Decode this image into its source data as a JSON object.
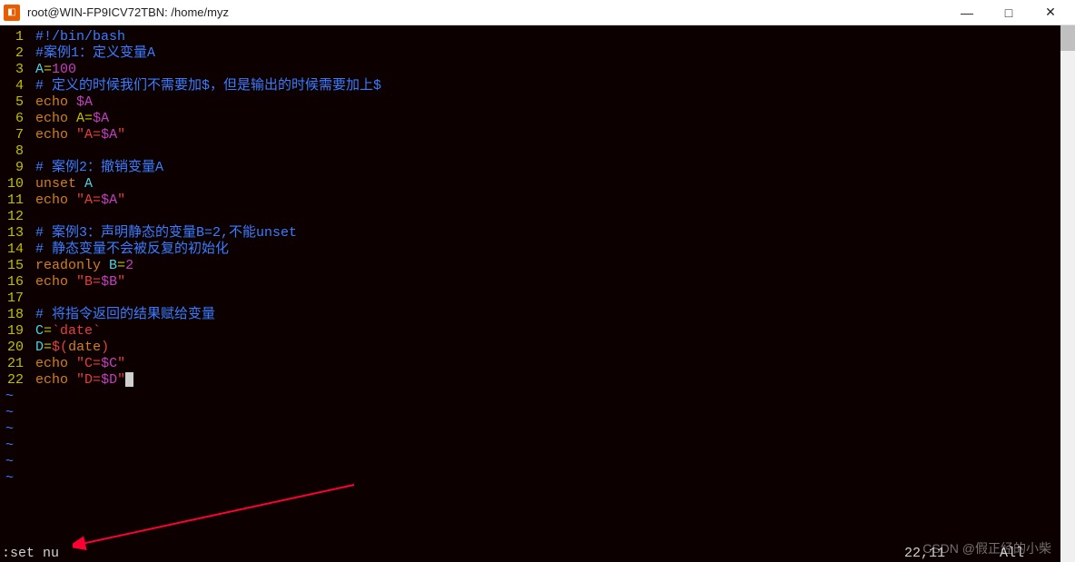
{
  "window": {
    "title": "root@WIN-FP9ICV72TBN: /home/myz",
    "controls": {
      "min": "—",
      "max": "□",
      "close": "✕"
    }
  },
  "lines": [
    {
      "n": "1",
      "segs": [
        {
          "t": "#!/bin/bash",
          "c": "c-comment"
        }
      ]
    },
    {
      "n": "2",
      "segs": [
        {
          "t": "#案例1：定义变量A",
          "c": "c-comment"
        }
      ]
    },
    {
      "n": "3",
      "segs": [
        {
          "t": "A",
          "c": "c-cyan"
        },
        {
          "t": "=",
          "c": "c-yellow"
        },
        {
          "t": "100",
          "c": "c-purple"
        }
      ]
    },
    {
      "n": "4",
      "segs": [
        {
          "t": "# 定义的时候我们不需要加$，但是输出的时候需要加上$",
          "c": "c-comment"
        }
      ]
    },
    {
      "n": "5",
      "segs": [
        {
          "t": "echo ",
          "c": "c-gold"
        },
        {
          "t": "$A",
          "c": "c-purple"
        }
      ]
    },
    {
      "n": "6",
      "segs": [
        {
          "t": "echo ",
          "c": "c-gold"
        },
        {
          "t": "A",
          "c": "c-yellow"
        },
        {
          "t": "=",
          "c": "c-yellow"
        },
        {
          "t": "$A",
          "c": "c-purple"
        }
      ]
    },
    {
      "n": "7",
      "segs": [
        {
          "t": "echo ",
          "c": "c-gold"
        },
        {
          "t": "\"",
          "c": "c-red"
        },
        {
          "t": "A=",
          "c": "c-red"
        },
        {
          "t": "$A",
          "c": "c-purple"
        },
        {
          "t": "\"",
          "c": "c-red"
        }
      ]
    },
    {
      "n": "8",
      "segs": [
        {
          "t": "",
          "c": ""
        }
      ]
    },
    {
      "n": "9",
      "segs": [
        {
          "t": "# 案例2：撤销变量A",
          "c": "c-comment"
        }
      ]
    },
    {
      "n": "10",
      "segs": [
        {
          "t": "unset",
          "c": "c-gold"
        },
        {
          "t": " A",
          "c": "c-cyan"
        }
      ]
    },
    {
      "n": "11",
      "segs": [
        {
          "t": "echo ",
          "c": "c-gold"
        },
        {
          "t": "\"",
          "c": "c-red"
        },
        {
          "t": "A=",
          "c": "c-red"
        },
        {
          "t": "$A",
          "c": "c-purple"
        },
        {
          "t": "\"",
          "c": "c-red"
        }
      ]
    },
    {
      "n": "12",
      "segs": [
        {
          "t": "",
          "c": ""
        }
      ]
    },
    {
      "n": "13",
      "segs": [
        {
          "t": "# 案例3：声明静态的变量B=2,不能unset",
          "c": "c-comment"
        }
      ]
    },
    {
      "n": "14",
      "segs": [
        {
          "t": "# 静态变量不会被反复的初始化",
          "c": "c-comment"
        }
      ]
    },
    {
      "n": "15",
      "segs": [
        {
          "t": "readonly ",
          "c": "c-gold"
        },
        {
          "t": "B",
          "c": "c-cyan"
        },
        {
          "t": "=",
          "c": "c-yellow"
        },
        {
          "t": "2",
          "c": "c-purple"
        }
      ]
    },
    {
      "n": "16",
      "segs": [
        {
          "t": "echo ",
          "c": "c-gold"
        },
        {
          "t": "\"",
          "c": "c-red"
        },
        {
          "t": "B=",
          "c": "c-red"
        },
        {
          "t": "$B",
          "c": "c-purple"
        },
        {
          "t": "\"",
          "c": "c-red"
        }
      ]
    },
    {
      "n": "17",
      "segs": [
        {
          "t": "",
          "c": ""
        }
      ]
    },
    {
      "n": "18",
      "segs": [
        {
          "t": "# 将指令返回的结果赋给变量",
          "c": "c-comment"
        }
      ]
    },
    {
      "n": "19",
      "segs": [
        {
          "t": "C",
          "c": "c-cyan"
        },
        {
          "t": "=",
          "c": "c-yellow"
        },
        {
          "t": "`date`",
          "c": "c-red"
        }
      ]
    },
    {
      "n": "20",
      "segs": [
        {
          "t": "D",
          "c": "c-cyan"
        },
        {
          "t": "=",
          "c": "c-yellow"
        },
        {
          "t": "$(",
          "c": "c-red"
        },
        {
          "t": "date",
          "c": "c-gold"
        },
        {
          "t": ")",
          "c": "c-red"
        }
      ]
    },
    {
      "n": "21",
      "segs": [
        {
          "t": "echo ",
          "c": "c-gold"
        },
        {
          "t": "\"",
          "c": "c-red"
        },
        {
          "t": "C=",
          "c": "c-red"
        },
        {
          "t": "$C",
          "c": "c-purple"
        },
        {
          "t": "\"",
          "c": "c-red"
        }
      ]
    },
    {
      "n": "22",
      "segs": [
        {
          "t": "echo ",
          "c": "c-gold"
        },
        {
          "t": "\"",
          "c": "c-red"
        },
        {
          "t": "D=",
          "c": "c-red"
        },
        {
          "t": "$D",
          "c": "c-purple"
        },
        {
          "t": "\"",
          "c": "c-red"
        }
      ],
      "cursor": true
    }
  ],
  "tildes": 6,
  "status": {
    "command": ":set nu",
    "pos": "22,11",
    "scroll": "All"
  },
  "watermark": "CSDN @假正经的小柴"
}
